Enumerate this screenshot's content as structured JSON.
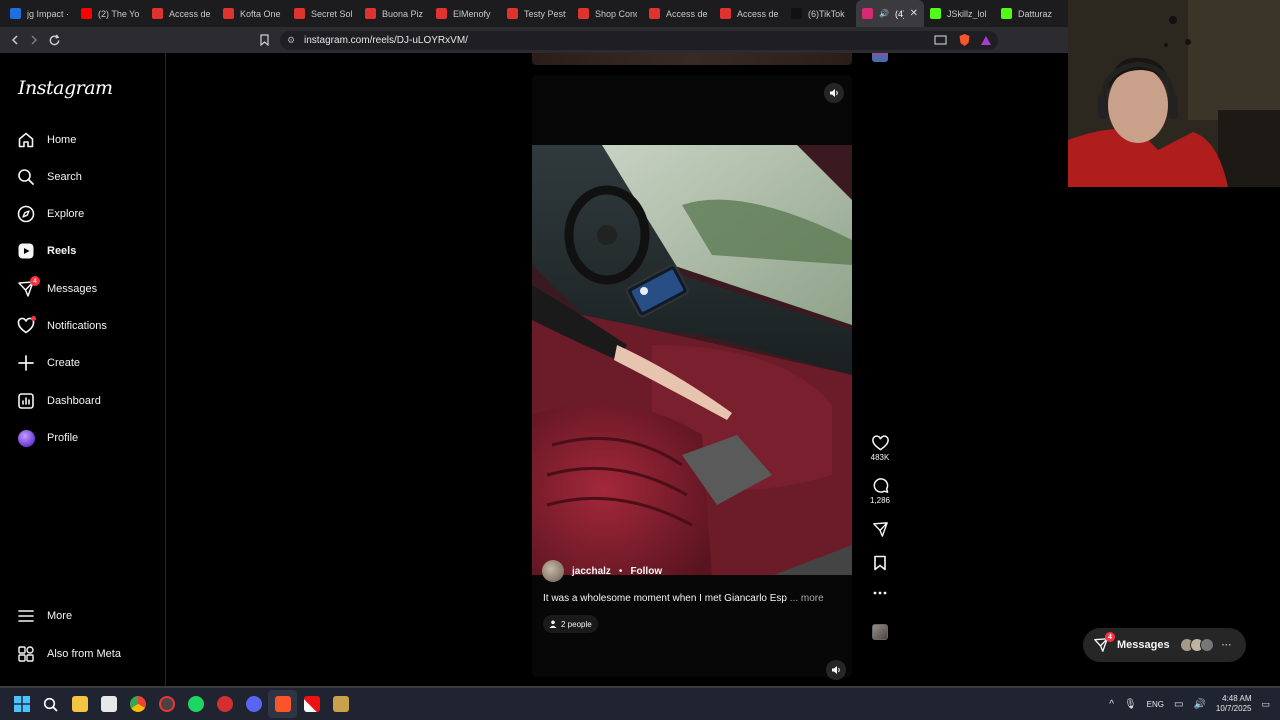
{
  "browser": {
    "tabs": [
      {
        "title": "jg Impact ·",
        "favicon_color": "#1f6fe0",
        "active": false
      },
      {
        "title": "(2) The Yo",
        "favicon_color": "#ff0000",
        "active": false
      },
      {
        "title": "Access de",
        "favicon_color": "#e0322f",
        "active": false
      },
      {
        "title": "Kofta One",
        "favicon_color": "#e0322f",
        "active": false
      },
      {
        "title": "Secret Sol",
        "favicon_color": "#e0322f",
        "active": false
      },
      {
        "title": "Buona Piz",
        "favicon_color": "#e0322f",
        "active": false
      },
      {
        "title": "ElMenofy",
        "favicon_color": "#e0322f",
        "active": false
      },
      {
        "title": "Testy Pesty",
        "favicon_color": "#e0322f",
        "active": false
      },
      {
        "title": "Shop Conc",
        "favicon_color": "#e0322f",
        "active": false
      },
      {
        "title": "Access de",
        "favicon_color": "#e0322f",
        "active": false
      },
      {
        "title": "Access de",
        "favicon_color": "#e0322f",
        "active": false
      },
      {
        "title": "(6)TikTok",
        "favicon_color": "#111111",
        "active": false
      },
      {
        "title": "(4)",
        "favicon_color": "#d62976",
        "active": true
      },
      {
        "title": "JSkillz_lol",
        "favicon_color": "#53fc18",
        "active": false
      },
      {
        "title": "Datturaz",
        "favicon_color": "#53fc18",
        "active": false
      }
    ],
    "url": "instagram.com/reels/DJ-uLOYRxVM/"
  },
  "sidebar": {
    "logo": "Instagram",
    "items": [
      {
        "label": "Home",
        "icon": "home-icon"
      },
      {
        "label": "Search",
        "icon": "search-icon"
      },
      {
        "label": "Explore",
        "icon": "compass-icon"
      },
      {
        "label": "Reels",
        "icon": "reels-icon",
        "active": true
      },
      {
        "label": "Messages",
        "icon": "messenger-icon",
        "badge": "4"
      },
      {
        "label": "Notifications",
        "icon": "heart-icon",
        "dot": true
      },
      {
        "label": "Create",
        "icon": "plus-icon"
      },
      {
        "label": "Dashboard",
        "icon": "dashboard-icon"
      },
      {
        "label": "Profile",
        "icon": "avatar"
      }
    ],
    "bottom": [
      {
        "label": "More",
        "icon": "menu-icon"
      },
      {
        "label": "Also from Meta",
        "icon": "meta-icon"
      }
    ]
  },
  "reel": {
    "username": "jacchalz",
    "separator": "•",
    "follow_label": "Follow",
    "caption": "It was a wholesome moment when I met Giancarlo Esp",
    "caption_more": "... more",
    "people_label": "2 people",
    "likes": "483K",
    "comments": "1,286"
  },
  "messages_pill": {
    "label": "Messages",
    "badge": "4"
  },
  "taskbar": {
    "language": "ENG",
    "time": "4:48 AM",
    "date": "10/7/2025"
  },
  "colors": {
    "accent_red": "#ff3040",
    "seat_red": "#8e1e2c",
    "background": "#000000"
  }
}
